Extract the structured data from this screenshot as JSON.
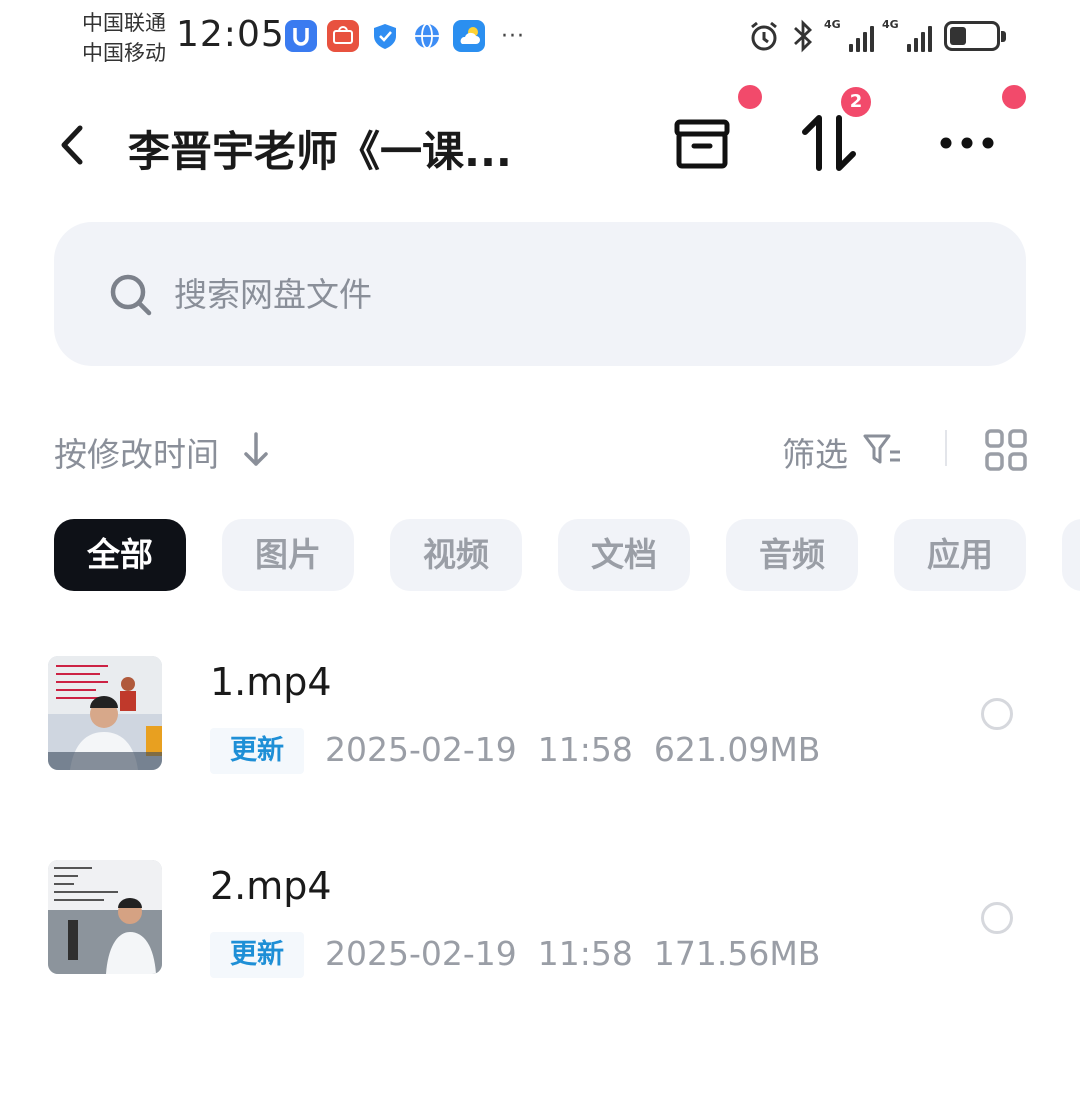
{
  "status_bar": {
    "carrier_1": "中国联通",
    "carrier_2": "中国移动",
    "time": "12:05",
    "more": "···",
    "net_1": "4G",
    "net_2": "4G",
    "app_icons": [
      "u-app-icon",
      "huawei-store-icon",
      "shield-icon",
      "browser-icon",
      "weather-icon"
    ]
  },
  "header": {
    "title": "李晋宇老师《一课...",
    "transfer_badge": "2"
  },
  "search": {
    "placeholder": "搜索网盘文件"
  },
  "sort": {
    "label": "按修改时间",
    "filter_label": "筛选"
  },
  "tabs": [
    {
      "label": "全部",
      "active": true
    },
    {
      "label": "图片",
      "active": false
    },
    {
      "label": "视频",
      "active": false
    },
    {
      "label": "文档",
      "active": false
    },
    {
      "label": "音频",
      "active": false
    },
    {
      "label": "应用",
      "active": false
    }
  ],
  "files": [
    {
      "name": "1.mp4",
      "tag": "更新",
      "date": "2025-02-19",
      "time": "11:58",
      "size": "621.09MB"
    },
    {
      "name": "2.mp4",
      "tag": "更新",
      "date": "2025-02-19",
      "time": "11:58",
      "size": "171.56MB"
    }
  ],
  "colors": {
    "accent_red": "#f24a6b",
    "tag_blue": "#1e8fd6",
    "active_tab_bg": "#0e1117",
    "search_bg": "#f1f3f8"
  }
}
